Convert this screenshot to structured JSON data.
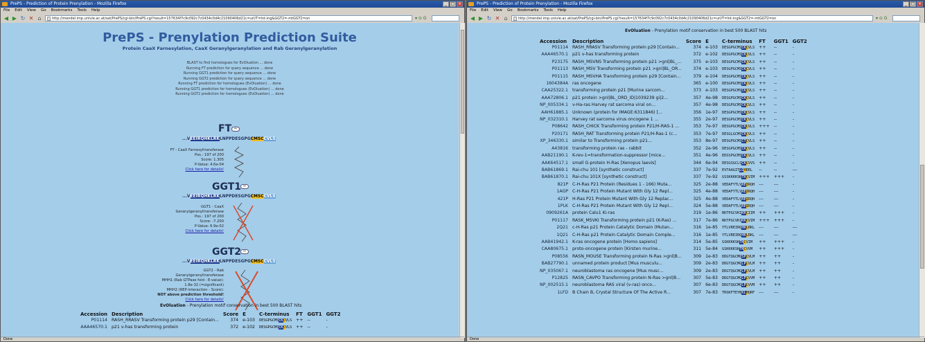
{
  "left_window": {
    "title": "PrePS - Prediction of Protein Prenylation - Mozilla Firefox",
    "menu": [
      "File",
      "Edit",
      "View",
      "Go",
      "Bookmarks",
      "Tools",
      "Help"
    ],
    "url": "http://mendel.imp.univie.ac.at/sat/PrePS/cgi-bin/PrePS.cgi?result=157634f7c9c092c7c0434c0d4c21090406d21c=url/T=Int-ing&GGT2=-mtGGT2=on",
    "status": "Done",
    "page_title": "PrePS - Prenylation Prediction Suite",
    "subtitle": "Protein CaaX Farnesylation, CaaX Geranylgeranylation and Rab Geranylgeranylation",
    "log": [
      "BLAST to find homologues for EvOluation ... done",
      "Running FT prediction for query sequence ... done",
      "Running GGT1 prediction for query sequence ... done",
      "Running GGT2 prediction for query sequence ... done",
      "Running FT prediction for homologues (EvOluation) ... done",
      "Running GGT1 prediction for homologues (EvOluation) ... done",
      "Running GGT2 prediction for homologues (EvOluation) ... done"
    ],
    "ft": {
      "heading": "FT",
      "seq_prefix": "...V",
      "seq_mid": "LNPPDESGPG",
      "seq_end": "CVLS",
      "lines": [
        "FT - CaaX Farnesyltransferase",
        "Pos.: 197 of 200",
        "Score: 1.305",
        "P-Value: 4.6e-04"
      ],
      "link": "Click here for details!"
    },
    "ggt1": {
      "heading": "GGT1",
      "seq_prefix": "...V",
      "seq_mid": "LNPPDESGPG",
      "seq_end": "CVLS",
      "lines": [
        "GGT1 - CaaX",
        "Geranylgeranyltransferase",
        "Pos.: 197 of 200",
        "Score: -7.200",
        "P-Value: 6.9e-02"
      ],
      "link": "Click here for details!"
    },
    "ggt2": {
      "heading": "GGT2",
      "seq_prefix": "...V",
      "seq_mid": "LNPPDESGPG",
      "seq_end": "CVLS",
      "lines": [
        "GGT2 - Rab",
        "Geranylgeranyltransferase",
        "MHH1 (Rab GTPase fold - E-value):",
        "1.8e-32 (=significant)",
        "MHH2 (REP-interaction - Score):"
      ],
      "bold_line": "NOT above prediction threshold!",
      "link": "Click here for details!"
    },
    "evo_heading": "EvOluation",
    "evo_desc": " - Prenylation motif conservation in best 500 BLAST hits",
    "columns": [
      "Accession",
      "Description",
      "Score",
      "E",
      "C-terminus",
      "FT",
      "GGT1",
      "GGT2"
    ],
    "rows": [
      [
        "P01114",
        "RASH_RRASV Transforming protein p29 [Contain...",
        "374",
        "e-103",
        "DESGPGCMSCKCVLS",
        "++",
        "--",
        "-"
      ],
      [
        "AAA46570.1",
        "p21 v-has transforming protein",
        "372",
        "e-102",
        "DESGPGCMSCKCVLS",
        "++",
        "--",
        "-"
      ]
    ]
  },
  "right_window": {
    "title": "PrePS - Prediction of Protein Prenylation - Mozilla Firefox",
    "menu": [
      "File",
      "Edit",
      "View",
      "Go",
      "Bookmarks",
      "Tools",
      "Help"
    ],
    "url": "http://mendel.imp.univie.ac.at/sat/PrePS/cgi-bin/PrePS.cgi?result=157634f7c9c092c7c0434c0d4c21090406d21c=url/T=Int-ing&GGT2=-mtGGT2=on",
    "status": "Done",
    "evo_heading": "EvOluation",
    "evo_desc": " - Prenylation motif conservation in best 500 BLAST hits",
    "columns": [
      "Accession",
      "Description",
      "Score",
      "E",
      "C-terminus",
      "FT",
      "GGT1",
      "GGT2"
    ],
    "rows": [
      [
        "P01114",
        "RASH_RRASV Transforming protein p29 [Contain...",
        "374",
        "e-103",
        "DESGPGCMSCKCVLS",
        "++",
        "--",
        "-"
      ],
      [
        "AAA46570.1",
        "p21 v-has transforming protein",
        "372",
        "e-102",
        "DESGPGCMSCKCVLS",
        "++",
        "--",
        "-"
      ],
      [
        "P23175",
        "RASH_MSVNS Transforming protein p21 >gnl|BL_...",
        "375",
        "e-103",
        "DESGPGCMSCKCVLS",
        "++",
        "--",
        "-"
      ],
      [
        "P01113",
        "RASH_MSV Transforming protein p21 >gnl|BL_OR...",
        "374",
        "e-103",
        "DESGPGCMSCKCVLS",
        "++",
        "--",
        "-"
      ],
      [
        "P01115",
        "RASH_MSVHA Transforming protein p29 [Contain...",
        "379",
        "e-104",
        "DESGPGCMSCKCVLS",
        "++",
        "--",
        "-"
      ],
      [
        "1604384A",
        "ras oncogene",
        "365",
        "e-100",
        "DESGPGCMSCKCVLS",
        "++",
        "--",
        "-"
      ],
      [
        "CAA25322.1",
        "transforming protein p21 [Murine sarcom...",
        "373",
        "e-103",
        "DESGPGCMSCKCVLS",
        "++",
        "--",
        "-"
      ],
      [
        "AAA72806.1",
        "p21 protein >gnl|BL_ORD_ID|1039239 gi|2...",
        "357",
        "4e-98",
        "DESGPGCMSCKCVLS",
        "++",
        "--",
        "-"
      ],
      [
        "NP_005334.1",
        "v-Ha-ras Harvey rat sarcoma viral on...",
        "357",
        "4e-98",
        "DESGPGCMSCKCVLS",
        "++",
        "--",
        "-"
      ],
      [
        "AAH61885.1",
        "Unknown (protein for IMAGE:6311846) [...",
        "356",
        "1e-97",
        "DESGPGCMSCKCVLS",
        "++",
        "--",
        "-"
      ],
      [
        "NP_032310.1",
        "Harvey rat sarcoma virus oncogene 1 ...",
        "355",
        "2e-97",
        "DESGPGCMSCKCVLS",
        "++",
        "--",
        "-"
      ],
      [
        "P08642",
        "RASH_CHICK Transforming protein P21/H-RAS-1 ...",
        "353",
        "7e-97",
        "DESGPGCMSCKCVLS",
        "+++",
        "--",
        "-"
      ],
      [
        "P20171",
        "RASH_RAT Transforming protein P21/H-Ras-1 (c...",
        "353",
        "7e-97",
        "DESGLGCMSCKCVLS",
        "++",
        "--",
        "-"
      ],
      [
        "XP_346330.1",
        "similar to Transforming protein p21...",
        "353",
        "8e-97",
        "DESGPGCMSCTCVLS",
        "++",
        "--",
        "-"
      ],
      [
        "A43816",
        "transforming protein ras - rabbit",
        "352",
        "2e-96",
        "DESGPGCMSCKCVLS",
        "++",
        "--",
        "-"
      ],
      [
        "AAB21190.1",
        "K-rev-1=transformation-suppressor [mice...",
        "351",
        "4e-96",
        "EDSSPGCMSCKCVLS",
        "++",
        "--",
        "-"
      ],
      [
        "AAK64517.1",
        "small G-protein H-Ras [Xenopus laevis]",
        "344",
        "6e-94",
        "DESGSGCLSCKCVVS",
        "++",
        "--",
        "-"
      ],
      [
        "BAB61869.1",
        "Rai-chu 101 [synthetic construct]",
        "337",
        "7e-92",
        "EVTAAGITLGHDEL",
        "--",
        "--",
        "---"
      ],
      [
        "BAB61870.1",
        "Rai-chu 101X [synthetic construct]",
        "337",
        "7e-92",
        "GSSKKKKSKTKCVIM",
        "+++",
        "+++",
        "-"
      ],
      [
        "821P",
        "C-H-Ras P21 Protein (Residues 1 - 166) Muta...",
        "325",
        "2e-88",
        "VEDAFYTLVREIRQH",
        "---",
        "---",
        "-"
      ],
      [
        "1AGP",
        "C-H-Ras P21 Protein Mutant With Gly 12 Repl...",
        "325",
        "4e-88",
        "VEDAFYTLVREIRQH",
        "---",
        "---",
        "-"
      ],
      [
        "421P",
        "H-Ras P21 Protein Mutant With Gly 12 Replac...",
        "325",
        "4e-88",
        "VEDAFYTLVREIRQH",
        "---",
        "---",
        "-"
      ],
      [
        "1PLK",
        "C-H-Ras P21 Protein Mutant With Gly 12 Repl...",
        "324",
        "5e-88",
        "VEDAFYTLVREIRQH",
        "---",
        "---",
        "-"
      ],
      [
        "0909261A",
        "protein Calu1 Ki-ras",
        "319",
        "1e-86",
        "RKTPGCVKIKKCIIM",
        "++",
        "+++",
        "-"
      ],
      [
        "P01117",
        "RASK_MSVKI Transforming protein p21 (K-Ras) ...",
        "317",
        "7e-86",
        "RKTPGCVKIKKCVIM",
        "+++",
        "+++",
        "-"
      ],
      [
        "2Q21",
        "c-H-Ras p21 Protein Catalytic Domain (Mutan...",
        "316",
        "1e-85",
        "YTLVREIRQHKLRKL",
        "---",
        "---",
        "---"
      ],
      [
        "1Q21",
        "C-H-Ras p21 Protein Catalytic Domain Comple...",
        "316",
        "1e-85",
        "YTLVREIRQHKLRKL",
        "---",
        "---",
        "---"
      ],
      [
        "AAB41942.1",
        "K-ras oncogene protein [Homo sapiens]",
        "314",
        "5e-85",
        "GSKKKKSKTKCVIM",
        "++",
        "+++",
        "-"
      ],
      [
        "CAA80675.1",
        "proto-oncogene protein [Kirsten murine...",
        "311",
        "5e-84",
        "GSKKKKSKTKCVVM",
        "++",
        "+++",
        "-"
      ],
      [
        "P08556",
        "RASN_MOUSE Transforming protein N-Ras >gnl|B...",
        "309",
        "1e-83",
        "DDGTQGCMGSPCVLM",
        "++",
        "++",
        "-"
      ],
      [
        "BAB27790.1",
        "unnamed protein product [Mus musculu...",
        "309",
        "2e-83",
        "DDGTQGCMGLPCVLM",
        "++",
        "++",
        "-"
      ],
      [
        "NP_035067.1",
        "neuroblastoma ras oncogene [Mus musc...",
        "309",
        "2e-83",
        "DDGTQGCMGLPCVLM",
        "++",
        "++",
        "-"
      ],
      [
        "P12825",
        "RASN_CAVPO Transforming protein N-Ras >gnl|B...",
        "307",
        "5e-83",
        "DDGTQGCMGLPCVVM",
        "++",
        "++",
        "-"
      ],
      [
        "NP_002515.1",
        "neuroblastoma RAS viral (v-ras) onco...",
        "307",
        "6e-83",
        "DDGTQGCMGLPCVVM",
        "++",
        "++",
        "-"
      ],
      [
        "1LFD",
        "B Chain B, Crystal Structure Of The Active R...",
        "307",
        "7e-83",
        "TRSKFTEYNKLHQRF",
        "---",
        "---",
        "-"
      ]
    ]
  },
  "colors": {
    "page_bg": "#a4cdea",
    "title": "#315c9e",
    "highlight_dark": "#1e3c8c",
    "highlight_yellow": "#f2c020"
  }
}
